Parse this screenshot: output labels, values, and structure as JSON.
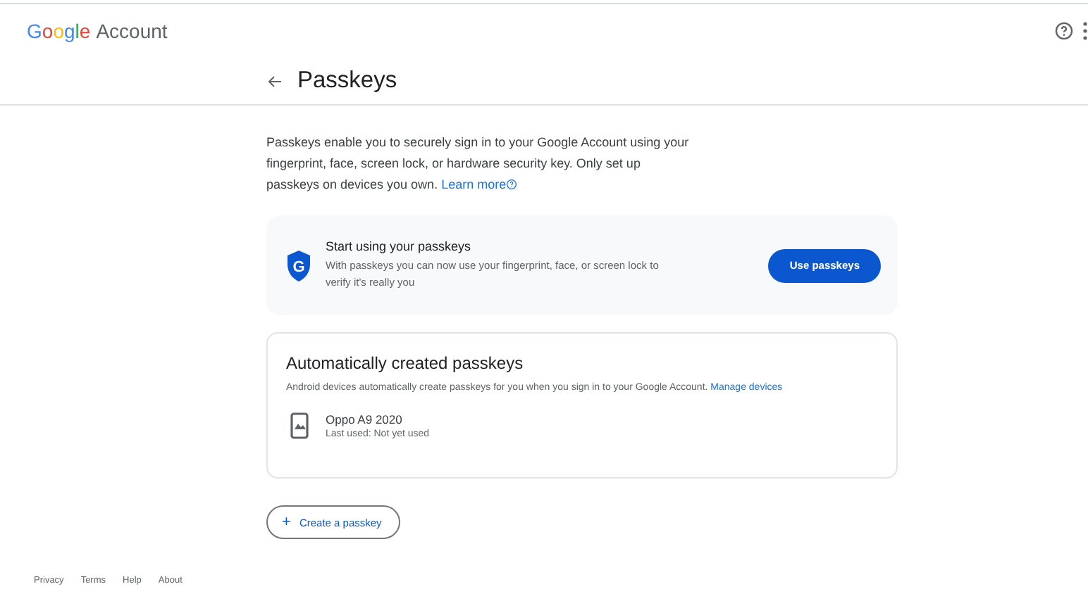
{
  "header": {
    "brand": "Google",
    "product": "Account"
  },
  "page": {
    "title": "Passkeys",
    "intro": "Passkeys enable you to securely sign in to your Google Account using your fingerprint, face, screen lock, or hardware security key. Only set up passkeys on devices you own.",
    "intro_link": "Learn more"
  },
  "promo": {
    "title": "Start using your passkeys",
    "text": "With passkeys you can now use your fingerprint, face, or screen lock to verify it's really you",
    "button": "Use passkeys",
    "badge": "G"
  },
  "auto_passkeys": {
    "title": "Automatically created passkeys",
    "text": "Android devices automatically create passkeys for you when you sign in to your Google Account.",
    "link": "Manage devices",
    "devices": [
      {
        "name": "Oppo A9 2020",
        "last_used": "Last used: Not yet used"
      }
    ]
  },
  "create_button": {
    "icon": "+",
    "label": "Create a passkey"
  },
  "footer": {
    "links": [
      "Privacy",
      "Terms",
      "Help",
      "About"
    ]
  }
}
